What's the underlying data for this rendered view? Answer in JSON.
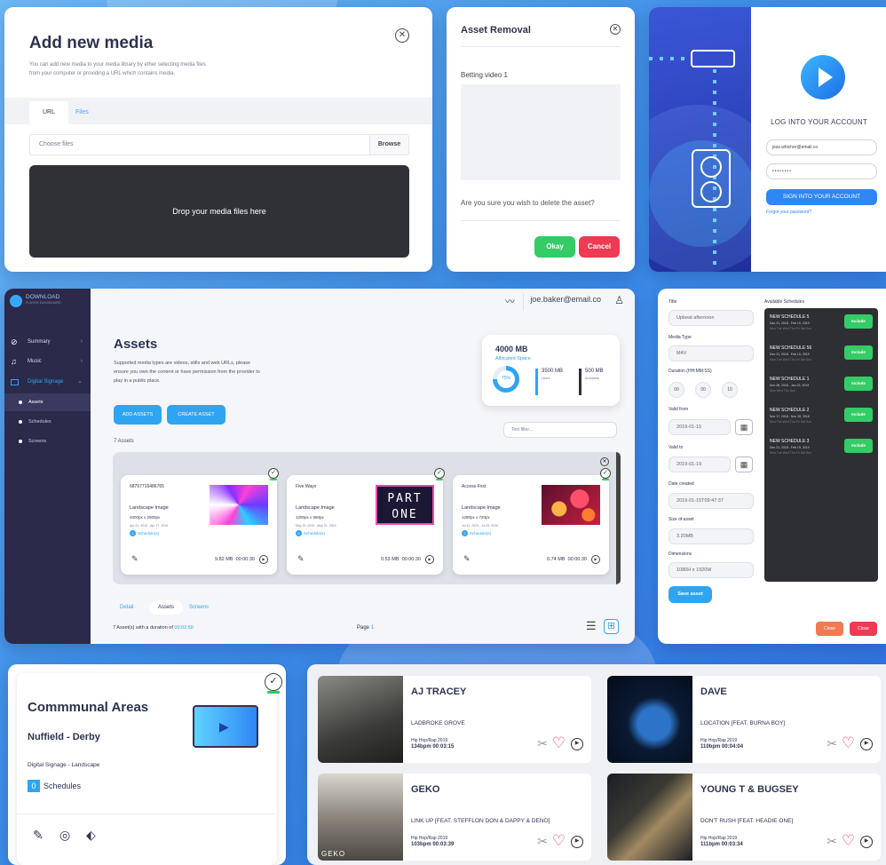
{
  "add_media": {
    "title": "Add new media",
    "description": "You can add new media to your media library by ether selecting media files from your computer or providing a URL which contains media.",
    "tabs": [
      "URL",
      "Files"
    ],
    "choose_placeholder": "Choose files",
    "browse_label": "Browse",
    "drop_text": "Drop your media files here"
  },
  "asset_removal": {
    "title": "Asset Removal",
    "asset_name": "Betting video 1",
    "confirm_text": "Are you sure you wish to delete the asset?",
    "okay_label": "Okay",
    "cancel_label": "Cancel"
  },
  "login": {
    "title": "LOG INTO YOUR ACCOUNT",
    "email_value": "jess.whicher@email.co",
    "password_value": "••••••••",
    "signin_label": "SIGN INTO YOUR ACCOUNT",
    "forgot_label": "Forgot your password?"
  },
  "dashboard": {
    "brand": "DOWNLOAD",
    "brand_sub": "PLAYER DASHBOARD",
    "user_email": "joe.baker@email.co",
    "nav": [
      {
        "label": "Summary",
        "icon": "compass-icon"
      },
      {
        "label": "Music",
        "icon": "music-note-icon"
      },
      {
        "label": "Digital Signage",
        "icon": "monitor-icon"
      }
    ],
    "subnav": [
      "Assets",
      "Schedules",
      "Screens"
    ],
    "title": "Assets",
    "subtitle": "Supported media types are videos, stills and web URLs, please ensure you own the content or have permission from the provider to play in a public place.",
    "add_assets_label": "ADD ASSETS",
    "create_asset_label": "CREATE ASSET",
    "asset_count": "7 Assets",
    "filter_placeholder": "Text filter...",
    "storage": {
      "total": "4000 MB",
      "total_caption": "Allocated Space",
      "percent": "75%",
      "used": "3500 MB",
      "used_caption": "Used",
      "available": "500 MB",
      "available_caption": "Available",
      "colors": {
        "used": "#2fa5f2",
        "available": "#2d2f3a"
      }
    },
    "assets": [
      {
        "id": "68767716486765",
        "type": "Landscape Image",
        "res": "4000px x 2500px",
        "dates": "Apr 22, 2019 - Apr 27, 2019",
        "schedules": "Schedule(s)",
        "size": "9.82 MB",
        "duration": "00:00:30",
        "thumb": "swirl"
      },
      {
        "id": "Five Ways",
        "type": "Landscape Image",
        "res": "1200px x 650px",
        "dates": "May 20, 2019 - May 21, 2019",
        "schedules": "Schedule(s)",
        "size": "0.53 MB",
        "duration": "00:00:30",
        "thumb": "part-one"
      },
      {
        "id": "Access First",
        "type": "Landscape Image",
        "res": "1280px x 720px",
        "dates": "Jul 11, 2019 - Jul 15, 2019",
        "schedules": "Schedule(s)",
        "size": "0.74 MB",
        "duration": "00:00:30",
        "thumb": "orbs"
      }
    ],
    "thumb_text": [
      "PART",
      "ONE"
    ],
    "bottom_tabs": [
      "Detail",
      "Assets",
      "Screens"
    ],
    "footer_prefix": "7 Asset(s) with a duration of",
    "footer_duration": "00:02:50",
    "page_label": "Page",
    "page_number": "1"
  },
  "edit_asset": {
    "fields": [
      {
        "label": "Title",
        "value": "Upbeat afternoon"
      },
      {
        "label": "Media Type",
        "value": "M4V"
      },
      {
        "label": "Duration (HH:MM:SS)",
        "value": ""
      },
      {
        "label": "Valid from",
        "value": "2019-01-15"
      },
      {
        "label": "Valid to",
        "value": "2019-01-19"
      },
      {
        "label": "Date created",
        "value": "2019-01-15T09:47:37"
      },
      {
        "label": "Size of asset",
        "value": "3.20MB"
      },
      {
        "label": "Dimensions",
        "value": "1080H x 1920W"
      }
    ],
    "duration_parts": [
      "00",
      "00",
      "10"
    ],
    "save_label": "Save asset",
    "available_label": "Available Schedules",
    "schedules": [
      {
        "name": "NEW SCHEDULE 5",
        "dates": "Dec 21, 2018 - Feb 19, 2019",
        "days": "Mon Tue Wed Thu Fri Sat Sun"
      },
      {
        "name": "NEW SCHEDULE 56",
        "dates": "Dec 21, 2018 - Feb 19, 2019",
        "days": "Mon Tue Wed Thu Fri Sat Sun"
      },
      {
        "name": "NEW SCHEDULE 1",
        "dates": "Nov 28, 2018 - Jan 22, 2019",
        "days": "Mon Wed Thu Sun"
      },
      {
        "name": "NEW SCHEDULE 2",
        "dates": "Nov 17, 2018 - Nov 28, 2018",
        "days": "Mon Tue Wed Thu Fri Sat Sun"
      },
      {
        "name": "NEW SCHEDULE 3",
        "dates": "Dec 21, 2018 - Feb 19, 2019",
        "days": "Mon Tue Wed Thu Fri Sat Sun"
      }
    ],
    "include_label": "Include",
    "close_label": "Close"
  },
  "screen": {
    "title": "Commmunal Areas",
    "location": "Nuffield - Derby",
    "kind": "Digital Signage - Landscape",
    "schedule_count": "0",
    "schedule_label": "Schedules"
  },
  "tracks": [
    {
      "artist": "AJ TRACEY",
      "song": "LADBROKE GROVE",
      "genre": "Hip Hop/Rap 2019",
      "stats": "134bpm 00:03:15",
      "art": "#4b4c4a"
    },
    {
      "artist": "DAVE",
      "song": "LOCATION [FEAT. BURNA BOY]",
      "genre": "Hip Hop/Rap 2019",
      "stats": "110bpm 00:04:04",
      "art": "#0f2b57"
    },
    {
      "artist": "GEKO",
      "song": "LINK UP [FEAT. STEFFLON DON & DAPPY & DENO]",
      "genre": "Hip Hop/Rap 2019",
      "stats": "103bpm 00:03:39",
      "art": "#6b6660"
    },
    {
      "artist": "YOUNG T & BUGSEY",
      "song": "DON'T RUSH [FEAT. HEADIE ONE]",
      "genre": "Hip Hop/Rap 2019",
      "stats": "111bpm 00:03:34",
      "art": "#1d2029"
    }
  ],
  "album_text": [
    "GEKO"
  ]
}
